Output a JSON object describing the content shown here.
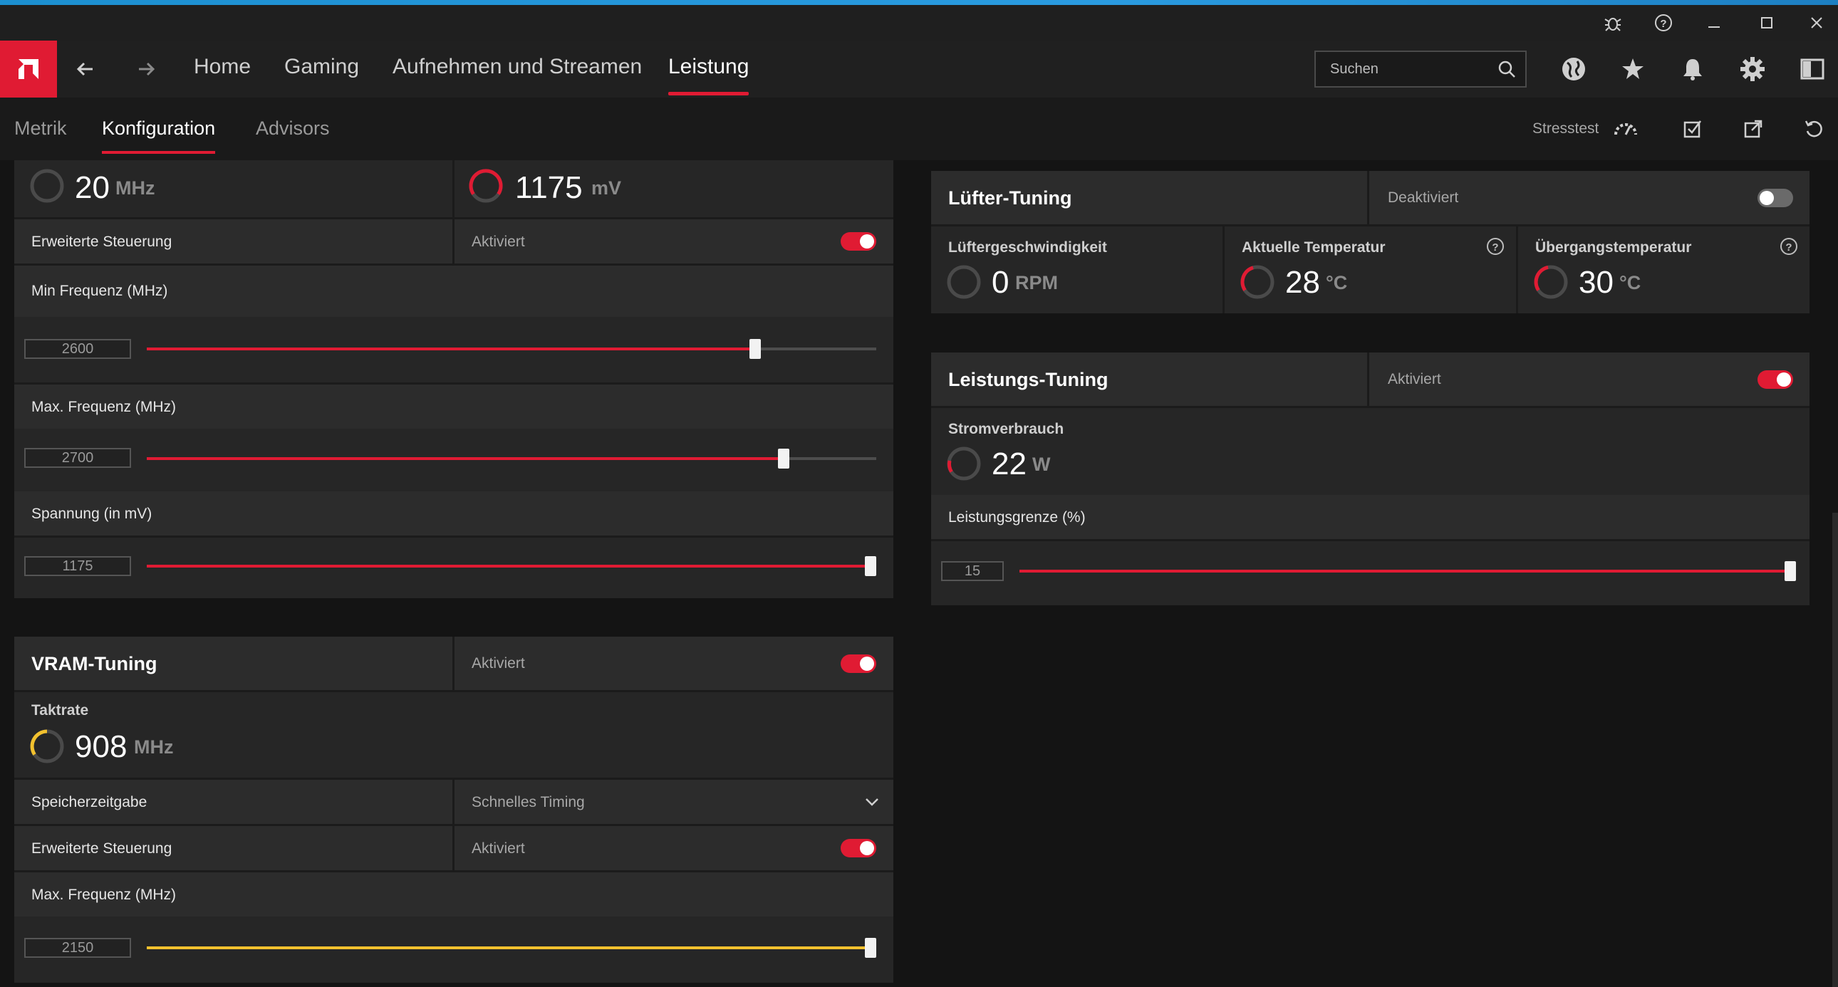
{
  "window": {
    "controls": [
      "bug-icon",
      "help-icon",
      "minimize-icon",
      "maximize-icon",
      "close-icon"
    ]
  },
  "nav": {
    "tabs": [
      {
        "label": "Home"
      },
      {
        "label": "Gaming"
      },
      {
        "label": "Aufnehmen und Streamen"
      },
      {
        "label": "Leistung"
      }
    ],
    "active_tab": "Leistung",
    "search_placeholder": "Suchen"
  },
  "subnav": {
    "tabs": [
      {
        "label": "Metrik"
      },
      {
        "label": "Konfiguration"
      },
      {
        "label": "Advisors"
      }
    ],
    "active_tab": "Konfiguration",
    "stresstest_label": "Stresstest"
  },
  "colors": {
    "accent_red": "#e01b33",
    "accent_yellow": "#f2c12e",
    "top_stripe": "#1c8fd0"
  },
  "gpu_tuning": {
    "clock_value": "20",
    "clock_unit": "MHz",
    "voltage_value": "1175",
    "voltage_unit": "mV",
    "advanced_label": "Erweiterte Steuerung",
    "advanced_state": "Aktiviert",
    "advanced_enabled": true,
    "sliders": [
      {
        "label": "Min Frequenz (MHz)",
        "value": "2600",
        "fraction": 0.834
      },
      {
        "label": "Max. Frequenz (MHz)",
        "value": "2700",
        "fraction": 0.873
      },
      {
        "label": "Spannung (in mV)",
        "value": "1175",
        "fraction": 1.0
      }
    ]
  },
  "vram_tuning": {
    "title": "VRAM-Tuning",
    "state": "Aktiviert",
    "enabled": true,
    "clock_label": "Taktrate",
    "clock_value": "908",
    "clock_unit": "MHz",
    "memory_timing_label": "Speicherzeitgabe",
    "memory_timing_value": "Schnelles Timing",
    "advanced_label": "Erweiterte Steuerung",
    "advanced_state": "Aktiviert",
    "advanced_enabled": true,
    "slider": {
      "label": "Max. Frequenz (MHz)",
      "value": "2150",
      "fraction": 1.0
    }
  },
  "fan_tuning": {
    "title": "Lüfter-Tuning",
    "state": "Deaktiviert",
    "enabled": false,
    "metrics": [
      {
        "label": "Lüftergeschwindigkeit",
        "value": "0",
        "unit": "RPM",
        "has_help": false
      },
      {
        "label": "Aktuelle Temperatur",
        "value": "28",
        "unit": "°C",
        "has_help": true
      },
      {
        "label": "Übergangstemperatur",
        "value": "30",
        "unit": "°C",
        "has_help": true
      }
    ]
  },
  "power_tuning": {
    "title": "Leistungs-Tuning",
    "state": "Aktiviert",
    "enabled": true,
    "consumption_label": "Stromverbrauch",
    "consumption_value": "22",
    "consumption_unit": "W",
    "limit_label": "Leistungsgrenze (%)",
    "limit_value": "15",
    "limit_fraction": 1.0
  }
}
